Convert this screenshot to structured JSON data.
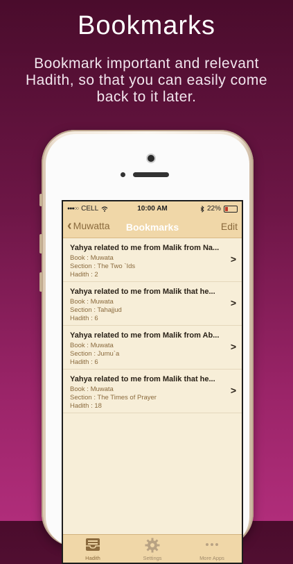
{
  "promo": {
    "title": "Bookmarks",
    "subtitle": "Bookmark important and relevant Hadith, so that you can easily come back to it later."
  },
  "status_bar": {
    "signal": "●●●○○",
    "carrier": "CELL",
    "time": "10:00 AM",
    "battery": "22%",
    "battery_level": 0.22
  },
  "nav": {
    "back_label": "Muwatta",
    "title": "Bookmarks",
    "edit_label": "Edit"
  },
  "bookmarks": [
    {
      "title": "Yahya related to me from Malik from Na...",
      "book": "Book : Muwata",
      "section": "Section : The Two `Ids",
      "hadith": "Hadith : 2"
    },
    {
      "title": "Yahya related to me from Malik that he...",
      "book": "Book : Muwata",
      "section": "Section : Tahajjud",
      "hadith": "Hadith : 6"
    },
    {
      "title": "Yahya related to me from Malik from Ab...",
      "book": "Book : Muwata",
      "section": "Section : Jumu`a",
      "hadith": "Hadith : 6"
    },
    {
      "title": "Yahya related to me from Malik that he...",
      "book": "Book : Muwata",
      "section": "Section : The Times of Prayer",
      "hadith": "Hadith : 18"
    }
  ],
  "tabs": [
    {
      "label": "Hadith",
      "icon": "inbox-tray-icon",
      "active": true
    },
    {
      "label": "Settings",
      "icon": "gear-icon",
      "active": false
    },
    {
      "label": "More Apps",
      "icon": "more-dots-icon",
      "active": false
    }
  ],
  "colors": {
    "bar_background": "#f0d7a8",
    "list_background": "#f7eed8",
    "accent_brown": "#8a6a3d"
  }
}
